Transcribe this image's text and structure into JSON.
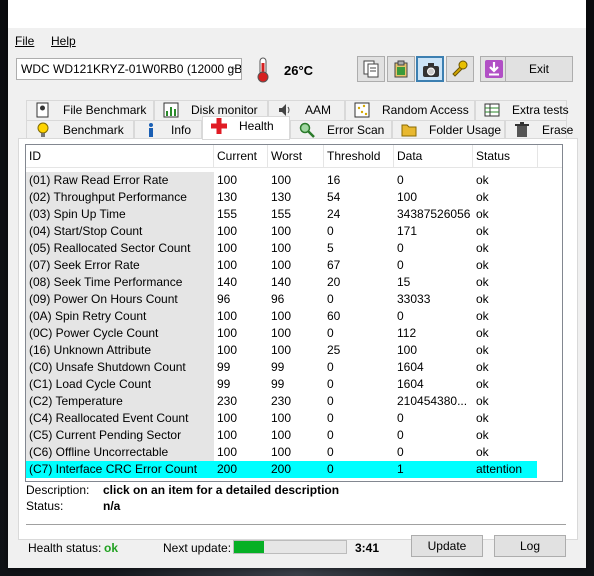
{
  "menu": {
    "file": "File",
    "help": "Help"
  },
  "toolbar": {
    "drive": "WDC WD121KRYZ-01W0RB0 (12000 gB",
    "temperature": "26°C",
    "exit_label": "Exit"
  },
  "tabs_top": [
    "File Benchmark",
    "Disk monitor",
    "AAM",
    "Random Access",
    "Extra tests"
  ],
  "tabs_bottom": [
    "Benchmark",
    "Info",
    "Health",
    "Error Scan",
    "Folder Usage",
    "Erase"
  ],
  "active_tab": "Health",
  "table": {
    "headers": [
      "ID",
      "Current",
      "Worst",
      "Threshold",
      "Data",
      "Status"
    ],
    "rows": [
      [
        "(01) Raw Read Error Rate",
        "100",
        "100",
        "16",
        "0",
        "ok"
      ],
      [
        "(02) Throughput Performance",
        "130",
        "130",
        "54",
        "100",
        "ok"
      ],
      [
        "(03) Spin Up Time",
        "155",
        "155",
        "24",
        "34387526056",
        "ok"
      ],
      [
        "(04) Start/Stop Count",
        "100",
        "100",
        "0",
        "171",
        "ok"
      ],
      [
        "(05) Reallocated Sector Count",
        "100",
        "100",
        "5",
        "0",
        "ok"
      ],
      [
        "(07) Seek Error Rate",
        "100",
        "100",
        "67",
        "0",
        "ok"
      ],
      [
        "(08) Seek Time Performance",
        "140",
        "140",
        "20",
        "15",
        "ok"
      ],
      [
        "(09) Power On Hours Count",
        "96",
        "96",
        "0",
        "33033",
        "ok"
      ],
      [
        "(0A) Spin Retry Count",
        "100",
        "100",
        "60",
        "0",
        "ok"
      ],
      [
        "(0C) Power Cycle Count",
        "100",
        "100",
        "0",
        "112",
        "ok"
      ],
      [
        "(16) Unknown Attribute",
        "100",
        "100",
        "25",
        "100",
        "ok"
      ],
      [
        "(C0) Unsafe Shutdown Count",
        "99",
        "99",
        "0",
        "1604",
        "ok"
      ],
      [
        "(C1) Load Cycle Count",
        "99",
        "99",
        "0",
        "1604",
        "ok"
      ],
      [
        "(C2) Temperature",
        "230",
        "230",
        "0",
        "210454380...",
        "ok"
      ],
      [
        "(C4) Reallocated Event Count",
        "100",
        "100",
        "0",
        "0",
        "ok"
      ],
      [
        "(C5) Current Pending Sector",
        "100",
        "100",
        "0",
        "0",
        "ok"
      ],
      [
        "(C6) Offline Uncorrectable",
        "100",
        "100",
        "0",
        "0",
        "ok"
      ],
      [
        "(C7) Interface CRC Error Count",
        "200",
        "200",
        "0",
        "1",
        "attention"
      ]
    ],
    "highlight_color": "#00ffff"
  },
  "description": {
    "desc_label": "Description:",
    "desc_value": "click on an item for a detailed description",
    "status_label": "Status:",
    "status_value": "n/a"
  },
  "footer": {
    "health_label": "Health status:",
    "health_value": "ok",
    "next_update_label": "Next update:",
    "progress_fraction": 0.27,
    "time": "3:41",
    "update_label": "Update",
    "log_label": "Log"
  },
  "colors": {
    "ok_green": "#21a121",
    "progress": "#06b025",
    "attention": "#00ffff"
  }
}
